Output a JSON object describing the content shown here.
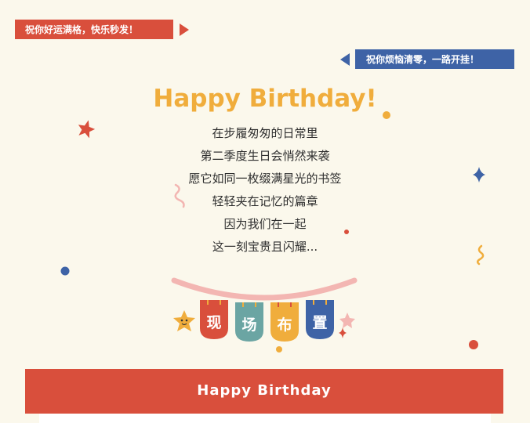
{
  "tags": {
    "left": "祝你好运满格，快乐秒发！",
    "right": "祝你烦恼清零，一路开挂！"
  },
  "title": "Happy Birthday!",
  "poem": [
    "在步履匆匆的日常里",
    "第二季度生日会悄然来袭",
    "愿它如同一枚缀满星光的书签",
    "轻轻夹在记忆的篇章",
    "因为我们在一起",
    "这一刻宝贵且闪耀..."
  ],
  "flags": [
    {
      "char": "现",
      "color": "#d94f3c"
    },
    {
      "char": "场",
      "color": "#6ba5a3"
    },
    {
      "char": "布",
      "color": "#f0ad3c"
    },
    {
      "char": "置",
      "color": "#3e63a6"
    }
  ],
  "section_banner": "Happy Birthday",
  "colors": {
    "background": "#fbf8ec",
    "red": "#d94f3c",
    "blue": "#3e63a6",
    "yellow": "#f0ad3c",
    "teal": "#6ba5a3",
    "pink": "#f3b6b2"
  }
}
